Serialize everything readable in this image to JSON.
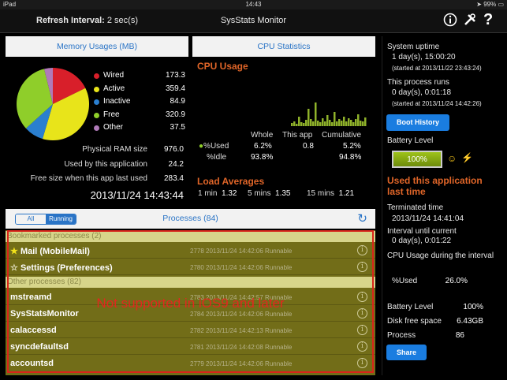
{
  "statusbar": {
    "device": "iPad",
    "time": "14:43",
    "battery": "99%"
  },
  "toolbar": {
    "refresh_label": "Refresh Interval:",
    "refresh_value": "2 sec(s)",
    "title": "SysStats Monitor"
  },
  "memory": {
    "title": "Memory Usages (MB)",
    "legend": [
      {
        "label": "Wired",
        "value": "173.3",
        "color": "#d81f2a"
      },
      {
        "label": "Active",
        "value": "359.4",
        "color": "#e8e41a"
      },
      {
        "label": "Inactive",
        "value": "84.9",
        "color": "#2a7fd0"
      },
      {
        "label": "Free",
        "value": "320.9",
        "color": "#8fce2a"
      },
      {
        "label": "Other",
        "value": "37.5",
        "color": "#b07ab8"
      }
    ],
    "stats": [
      {
        "label": "Physical RAM size",
        "value": "976.0"
      },
      {
        "label": "Used by this application",
        "value": "24.2"
      },
      {
        "label": "Free size when this app last used",
        "value": "283.4"
      }
    ],
    "datetime": "2013/11/24 14:43:44"
  },
  "cpu": {
    "title": "CPU Statistics",
    "usage_title": "CPU Usage",
    "columns": [
      "Whole",
      "This app",
      "Cumulative"
    ],
    "rows": [
      {
        "label": "%Used",
        "whole": "6.2%",
        "app": "0.8",
        "cumulative": "5.2%"
      },
      {
        "label": "%Idle",
        "whole": "93.8%",
        "app": "",
        "cumulative": "94.8%"
      }
    ],
    "load_title": "Load Averages",
    "load": [
      {
        "label": "1 min",
        "value": "1.32"
      },
      {
        "label": "5 mins",
        "value": "1.35"
      },
      {
        "label": "15 mins",
        "value": "1.21"
      }
    ],
    "graph_color": "#8fb22a"
  },
  "side": {
    "uptime_label": "System uptime",
    "uptime_value": "1 day(s), 15:00:20",
    "uptime_started": "(started at 2013/11/22 23:43:24)",
    "proc_label": "This process runs",
    "proc_value": "0 day(s), 0:01:18",
    "proc_started": "(started at 2013/11/24 14:42:26)",
    "boot_history": "Boot History",
    "battery_label": "Battery Level",
    "battery_value": "100%",
    "battery_level": 100,
    "last_used_title": "Used this application last time",
    "terminated_label": "Terminated time",
    "terminated_value": "2013/11/24 14:41:04",
    "interval_label": "Interval until current",
    "interval_value": "0 day(s), 0:01:22",
    "cpu_during_label": "CPU Usage during the interval",
    "used_label": "%Used",
    "used_value": "26.0%",
    "battery_level_label": "Battery Level",
    "battery_level_value": "100%",
    "disk_label": "Disk free space",
    "disk_value": "6.43GB",
    "process_label": "Process",
    "process_value": "86",
    "share": "Share"
  },
  "processes": {
    "title": "Processes (84)",
    "seg_all": "All",
    "seg_running": "Running",
    "bookmarked_header": "Bookmarked processes (2)",
    "bookmarked": [
      {
        "name": "Mail (MobileMail)",
        "meta": "2778 2013/11/24 14:42:06 Runnable",
        "mark": "★"
      },
      {
        "name": "Settings (Preferences)",
        "meta": "2780 2013/11/24 14:42:06 Runnable",
        "mark": "☆"
      }
    ],
    "other_header": "Other processes (82)",
    "others": [
      {
        "name": "mstreamd",
        "meta": "2783 2013/11/24 14:42:57 Runnable"
      },
      {
        "name": "SysStatsMonitor",
        "meta": "2784 2013/11/24 14:42:06 Runnable"
      },
      {
        "name": "calaccessd",
        "meta": "2782 2013/11/24 14:42:13 Runnable"
      },
      {
        "name": "syncdefaultsd",
        "meta": "2781 2013/11/24 14:42:08 Runnable"
      },
      {
        "name": "accountsd",
        "meta": "2779 2013/11/24 14:42:06 Runnable"
      }
    ],
    "overlay": "Not supported in iOS9 and later"
  }
}
